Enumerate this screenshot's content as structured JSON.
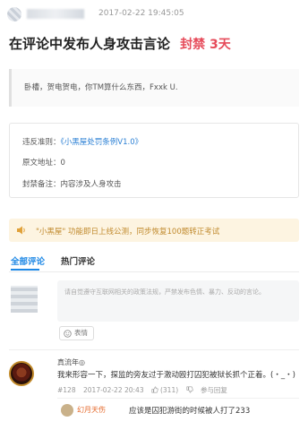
{
  "header": {
    "timestamp": "2017-02-22 19:45:05"
  },
  "title": {
    "text": "在评论中发布人身攻击言论",
    "ban_label": "封禁 3天"
  },
  "quote": {
    "text": "卧槽，贺电贺电，你TM算什么东西，Fxxk U."
  },
  "info": {
    "rule_label": "违反准则：",
    "rule_link": "《小黑屋处罚条例V1.0》",
    "source_label": "原文地址：",
    "source_value": "0",
    "note_label": "封禁备注：",
    "note_value": "内容涉及人身攻击"
  },
  "notice": {
    "text": "\"小黑屋\" 功能即日上线公测，同步恢复100题转正考试"
  },
  "tabs": [
    {
      "label": "全部评论"
    },
    {
      "label": "热门评论"
    }
  ],
  "composer": {
    "placeholder": "请自觉遵守互联网相关的政策法规，严禁发布色情、暴力、反动的言论。",
    "emoji_label": "表情"
  },
  "comment": {
    "user": "真流年◎",
    "text": "我来形容一下，探监的旁友过于激动殴打囚犯被狱长抓个正着。(・_・)",
    "floor": "#128",
    "time": "2017-02-22 20:43",
    "likes": "(311)",
    "reply_label": "参与回复"
  },
  "reply": {
    "user": "幻月天伤",
    "text": "应该是囚犯游街的时候被人打了233"
  },
  "colors": {
    "ban_red": "#e64b5a",
    "link_blue": "#2a7fd4",
    "tab_active": "#1e88e5",
    "notice_bg": "#fdf4e1",
    "notice_text": "#c0892c"
  }
}
